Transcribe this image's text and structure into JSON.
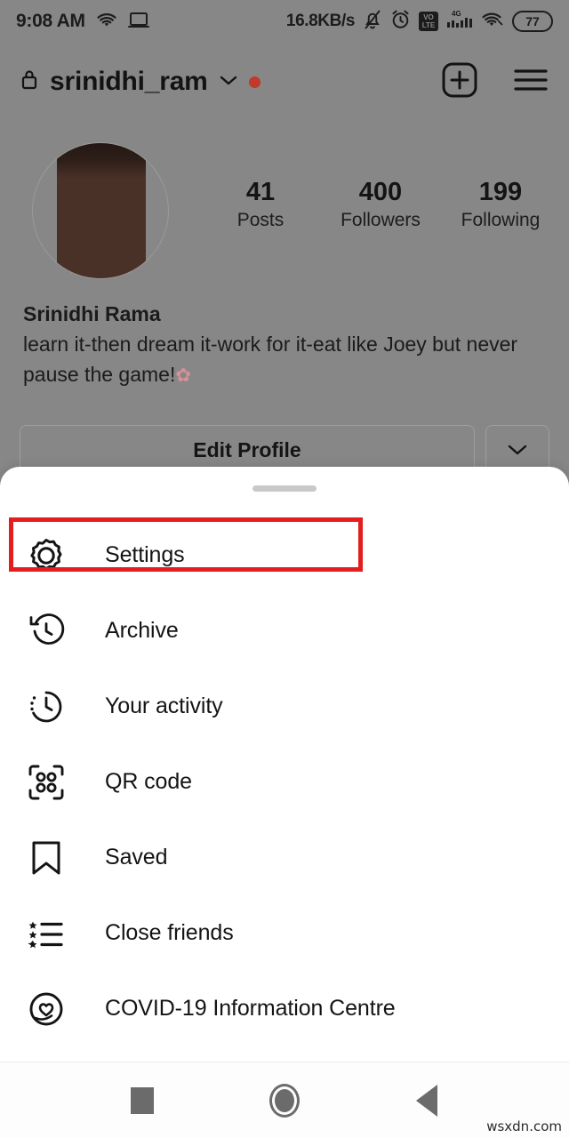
{
  "status_bar": {
    "time": "9:08 AM",
    "network_speed": "16.8KB/s",
    "battery_level": "77",
    "volte_top": "VO",
    "volte_bottom": "LTE",
    "signal_net": "4G",
    "icons": [
      "wifi-icon",
      "cast-icon",
      "notification-muted-icon",
      "alarm-icon",
      "volte-icon",
      "cellular-signal-icon",
      "wifi-icon",
      "battery-icon"
    ]
  },
  "profile_header": {
    "username": "srinidhi_ram",
    "lock_icon": "lock-icon",
    "chevron_icon": "chevron-down-icon",
    "has_unread_dot": true,
    "add_button": "add-post-button",
    "menu_button": "hamburger-menu-button"
  },
  "stats": [
    {
      "value": "41",
      "label": "Posts"
    },
    {
      "value": "400",
      "label": "Followers"
    },
    {
      "value": "199",
      "label": "Following"
    }
  ],
  "bio": {
    "display_name": "Srinidhi Rama",
    "text": "learn it-then dream it-work for it-eat like Joey but never pause the game!",
    "emoji": "✿"
  },
  "actions": {
    "edit_profile_label": "Edit Profile",
    "expand_icon": "chevron-down-icon"
  },
  "sheet": {
    "handle": "drag-handle",
    "items": [
      {
        "label": "Settings",
        "icon": "gear-icon",
        "highlighted": true
      },
      {
        "label": "Archive",
        "icon": "archive-clock-icon",
        "highlighted": false
      },
      {
        "label": "Your activity",
        "icon": "activity-clock-icon",
        "highlighted": false
      },
      {
        "label": "QR code",
        "icon": "qr-code-icon",
        "highlighted": false
      },
      {
        "label": "Saved",
        "icon": "bookmark-icon",
        "highlighted": false
      },
      {
        "label": "Close friends",
        "icon": "star-list-icon",
        "highlighted": false
      },
      {
        "label": "COVID-19 Information Centre",
        "icon": "heart-circle-icon",
        "highlighted": false
      }
    ]
  },
  "highlight_color": "#e41e1e",
  "nav_bar": {
    "recents_label": "recents-button",
    "home_label": "home-button",
    "back_label": "back-button"
  },
  "watermark": "wsxdn.com"
}
